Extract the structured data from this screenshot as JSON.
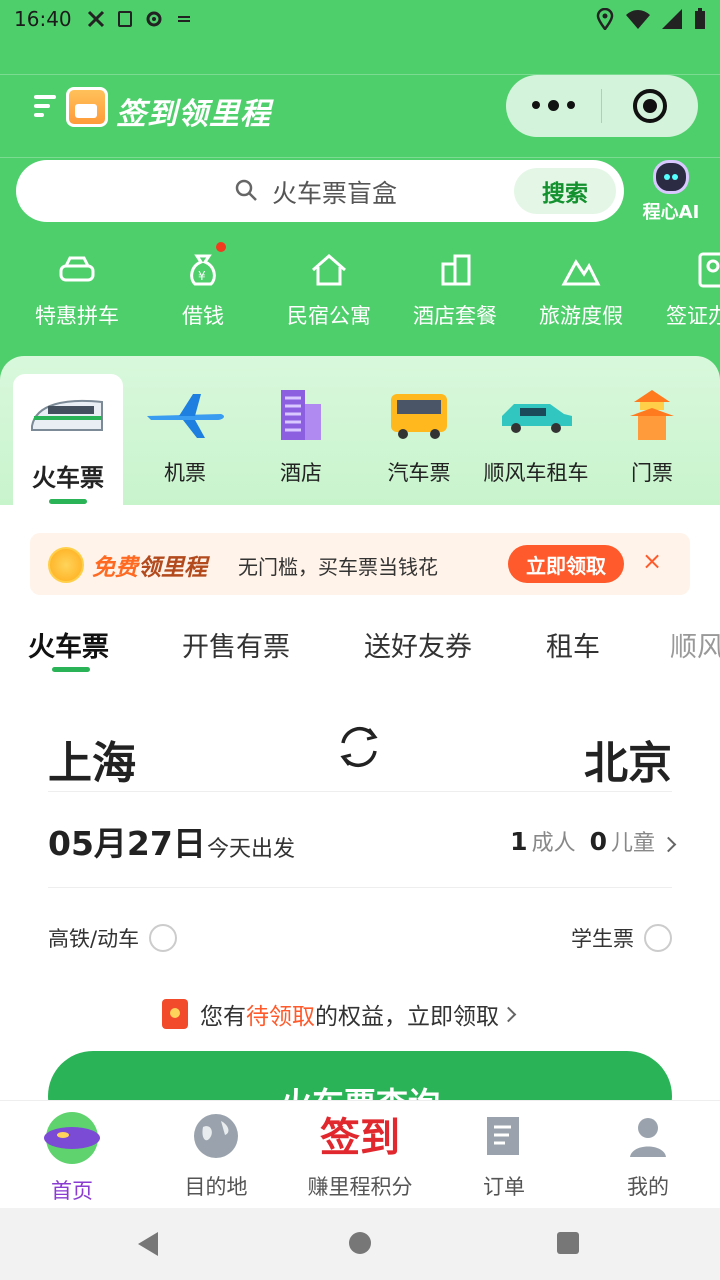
{
  "status_bar": {
    "time": "16:40"
  },
  "header": {
    "title": "签到领里程"
  },
  "search": {
    "placeholder": "火车票盲盒",
    "button": "搜索"
  },
  "ai": {
    "label": "程心AI"
  },
  "quick_menu": [
    "特惠拼车",
    "借钱",
    "民宿公寓",
    "酒店套餐",
    "旅游度假",
    "签证办"
  ],
  "categories": [
    "火车票",
    "机票",
    "酒店",
    "汽车票",
    "顺风车租车",
    "门票"
  ],
  "promo": {
    "title_a": "免费",
    "title_b": "领里程",
    "desc": "无门槛，买车票当钱花",
    "button": "立即领取",
    "close": "×"
  },
  "tabs": [
    "火车票",
    "开售有票",
    "送好友券",
    "租车",
    "顺风"
  ],
  "trip": {
    "from": "上海",
    "to": "北京",
    "date": "05月27日",
    "date_note": "今天出发",
    "adults": "1",
    "adults_label": "成人",
    "children": "0",
    "children_label": "儿童",
    "option_left": "高铁/动车",
    "option_right": "学生票",
    "benefit_a": "您有",
    "benefit_b": "待领取",
    "benefit_c": "的权益，立即领取",
    "query_button": "火车票查询"
  },
  "bottom_nav": {
    "home": "首页",
    "destination": "目的地",
    "signin_big": "签到",
    "signin": "赚里程积分",
    "orders": "订单",
    "mine": "我的"
  },
  "colors": {
    "brand_green": "#4fcf6c",
    "accent_orange": "#ff5a2b",
    "active_purple": "#8a3bd1"
  }
}
